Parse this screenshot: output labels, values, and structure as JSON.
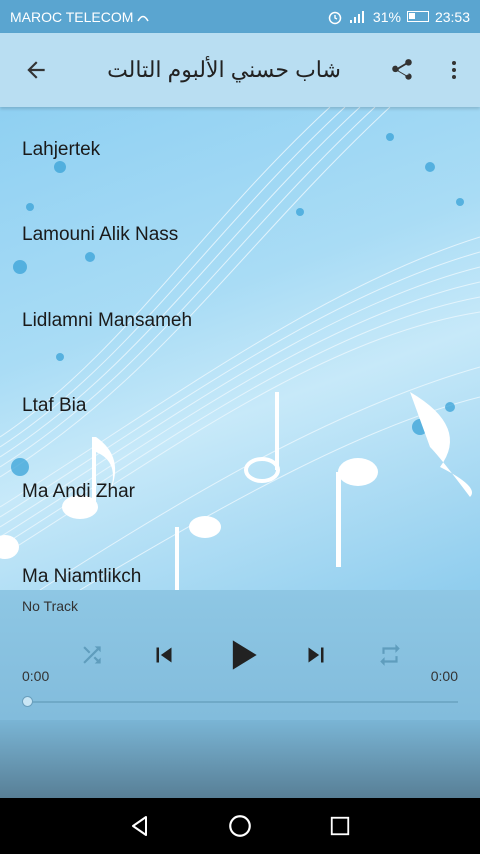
{
  "status": {
    "carrier": "MAROC TELECOM",
    "battery": "31%",
    "time": "23:53"
  },
  "appbar": {
    "title": "شاب حسني الألبوم التالت",
    "back_icon": "arrow-left-icon",
    "share_icon": "share-icon",
    "menu_icon": "more-vert-icon"
  },
  "tracks": [
    {
      "title": "Lahjertek"
    },
    {
      "title": "Lamouni Alik Nass"
    },
    {
      "title": "Lidlamni Mansameh"
    },
    {
      "title": "Ltaf Bia"
    },
    {
      "title": "Ma Andi Zhar"
    },
    {
      "title": "Ma Niamtlikch"
    }
  ],
  "player": {
    "now_playing": "No Track",
    "elapsed": "0:00",
    "duration": "0:00",
    "progress": 0
  },
  "colors": {
    "status_bar": "#5aa5d0",
    "app_bar": "#b9def2",
    "player_bg": "#8ec7e4"
  }
}
